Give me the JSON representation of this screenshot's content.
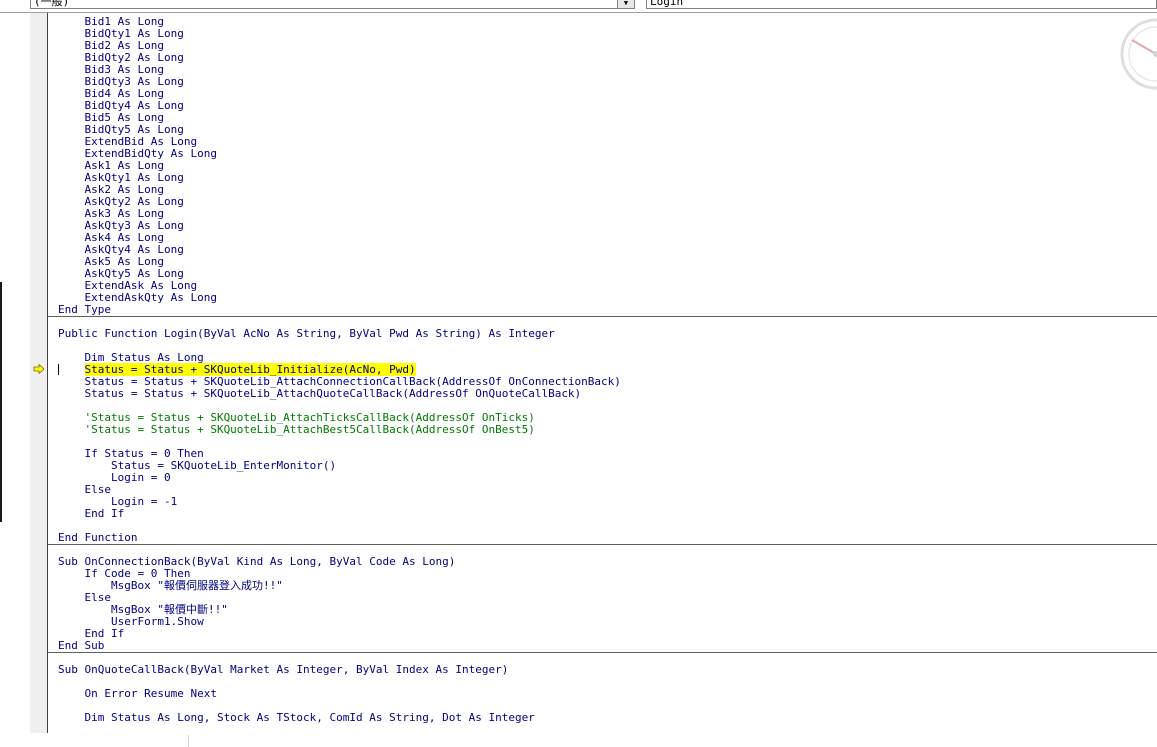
{
  "toolbar": {
    "object_combo_value": "(一般)",
    "procedure_combo_value": "Login",
    "dropdown_glyph": "▼"
  },
  "code_lines": {
    "l01": "    Bid1 As Long",
    "l02": "    BidQty1 As Long",
    "l03": "    Bid2 As Long",
    "l04": "    BidQty2 As Long",
    "l05": "    Bid3 As Long",
    "l06": "    BidQty3 As Long",
    "l07": "    Bid4 As Long",
    "l08": "    BidQty4 As Long",
    "l09": "    Bid5 As Long",
    "l10": "    BidQty5 As Long",
    "l11": "    ExtendBid As Long",
    "l12": "    ExtendBidQty As Long",
    "l13": "    Ask1 As Long",
    "l14": "    AskQty1 As Long",
    "l15": "    Ask2 As Long",
    "l16": "    AskQty2 As Long",
    "l17": "    Ask3 As Long",
    "l18": "    AskQty3 As Long",
    "l19": "    Ask4 As Long",
    "l20": "    AskQty4 As Long",
    "l21": "    Ask5 As Long",
    "l22": "    AskQty5 As Long",
    "l23": "    ExtendAsk As Long",
    "l24": "    ExtendAskQty As Long",
    "l25": "End Type",
    "l27": "Public Function Login(ByVal AcNo As String, ByVal Pwd As String) As Integer",
    "l29": "    Dim Status As Long",
    "l30_indent": "    ",
    "l30": "Status = Status + SKQuoteLib_Initialize(AcNo, Pwd)",
    "l31": "    Status = Status + SKQuoteLib_AttachConnectionCallBack(AddressOf OnConnectionBack)",
    "l32": "    Status = Status + SKQuoteLib_AttachQuoteCallBack(AddressOf OnQuoteCallBack)",
    "l34": "    'Status = Status + SKQuoteLib_AttachTicksCallBack(AddressOf OnTicks)",
    "l35": "    'Status = Status + SKQuoteLib_AttachBest5CallBack(AddressOf OnBest5)",
    "l37": "    If Status = 0 Then",
    "l38": "        Status = SKQuoteLib_EnterMonitor()",
    "l39": "        Login = 0",
    "l40": "    Else",
    "l41": "        Login = -1",
    "l42": "    End If",
    "l44": "End Function",
    "l46": "Sub OnConnectionBack(ByVal Kind As Long, ByVal Code As Long)",
    "l47": "    If Code = 0 Then",
    "l48": "        MsgBox \"報價伺服器登入成功!!\"",
    "l49": "    Else",
    "l50": "        MsgBox \"報價中斷!!\"",
    "l51": "        UserForm1.Show",
    "l52": "    End If",
    "l53": "End Sub",
    "l55": "Sub OnQuoteCallBack(ByVal Market As Integer, ByVal Index As Integer)",
    "l57": "    On Error Resume Next",
    "l59": "    Dim Status As Long, Stock As TStock, ComId As String, Dot As Integer"
  },
  "colors": {
    "keyword": "#000080",
    "comment": "#007a00",
    "highlight": "#ffff00",
    "exec_arrow": "#ffff00"
  },
  "icons": {
    "execution_pointer": "arrow-right-icon",
    "watermark": "speedometer-icon"
  }
}
